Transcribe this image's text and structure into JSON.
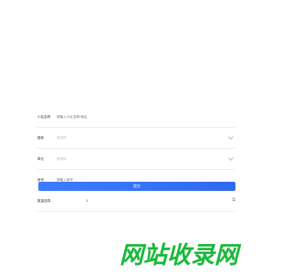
{
  "form": {
    "fields": [
      {
        "label": "小区名称",
        "placeholder": "请输入小区名称/地址"
      },
      {
        "label": "楼栋",
        "placeholder": "请选择"
      },
      {
        "label": "单元",
        "placeholder": "请选择"
      },
      {
        "label": "房号",
        "placeholder": "请输入房号"
      }
    ],
    "quantity": {
      "label": "数量选择",
      "value": "1"
    }
  },
  "submit": {
    "label": "提交"
  },
  "watermark": {
    "text": "网站收录网"
  },
  "colors": {
    "accent": "#2f6af0",
    "watermark": "#18b93a"
  },
  "icons": [
    "chevron-down-icon",
    "counter-icon"
  ]
}
